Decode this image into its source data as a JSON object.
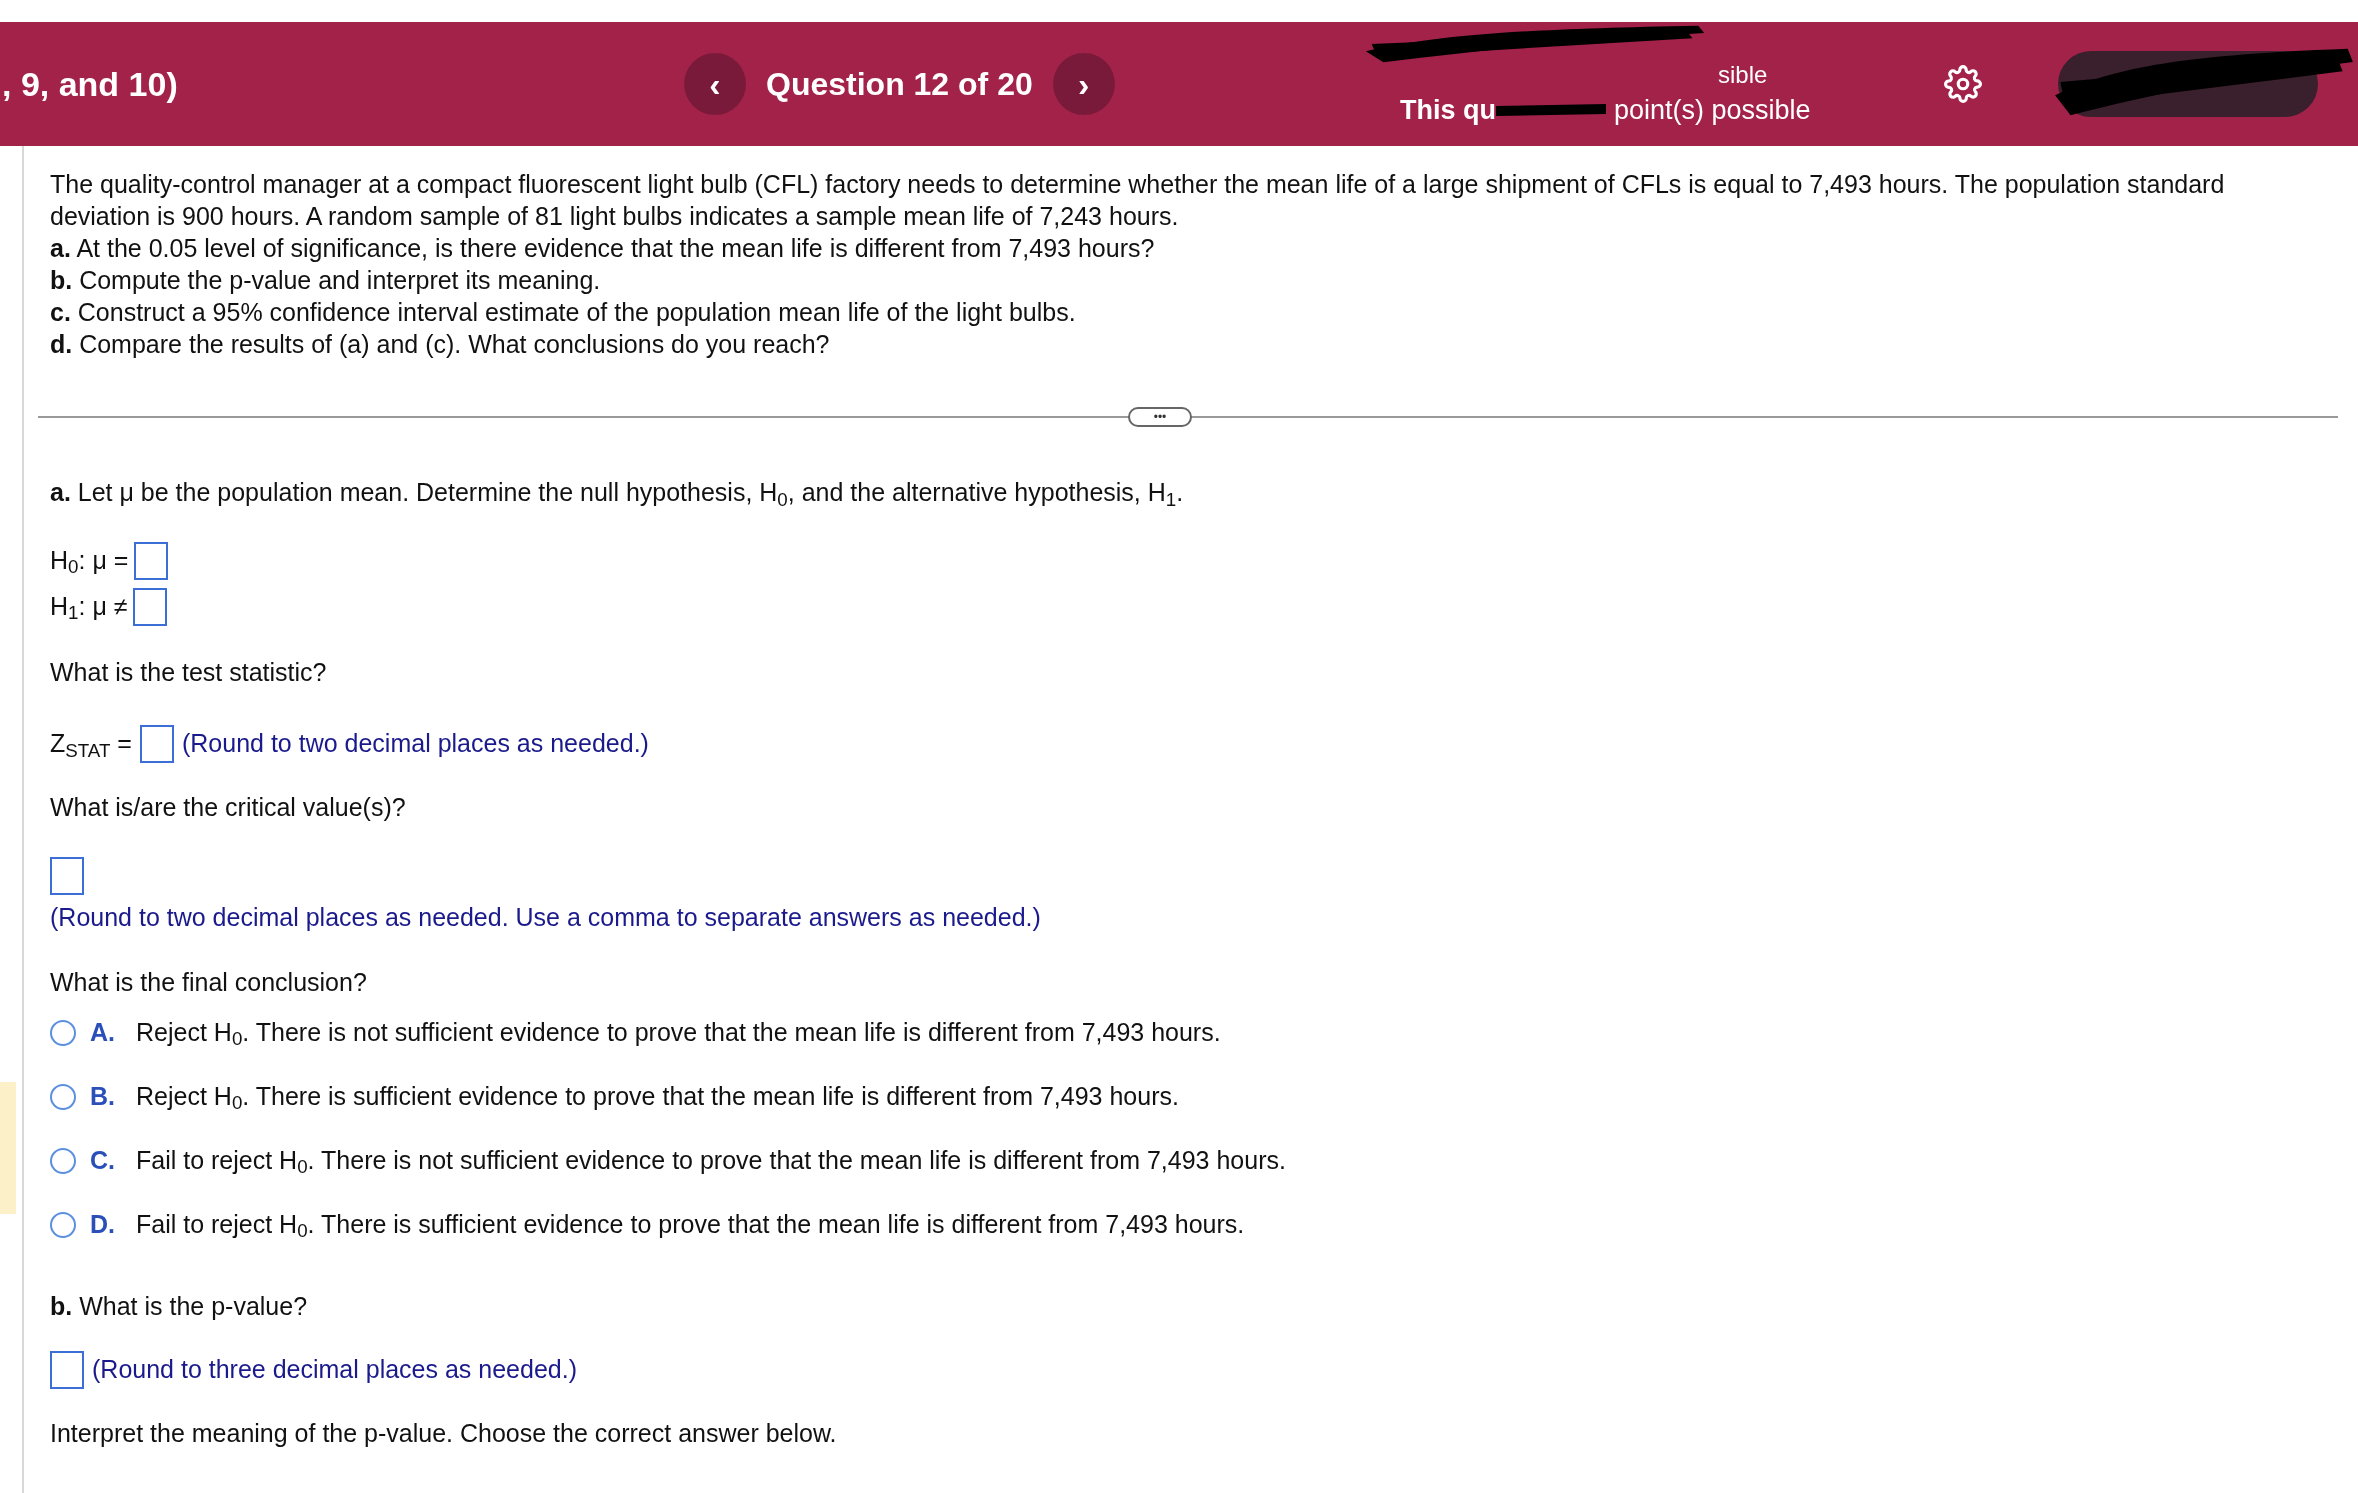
{
  "header": {
    "breadcrumb": ", 9, and 10)",
    "question_label": "Question 12 of 20",
    "prev": "‹",
    "next": "›",
    "points_top": "sible",
    "points_start": "This qu",
    "points_end": "point(s) possible"
  },
  "problem": {
    "intro": "The quality-control manager at a compact fluorescent light bulb (CFL) factory needs to determine whether the mean life of a large shipment of CFLs is equal to 7,493 hours. The population standard deviation is 900 hours. A random sample of 81 light bulbs indicates a sample mean life of 7,243 hours.",
    "parts": [
      "**a.** At the 0.05 level of significance, is there evidence that the mean life is different from 7,493 hours?",
      "**b.** Compute the p-value and interpret its meaning.",
      "**c.** Construct a 95% confidence interval estimate of the population mean life of the light bulbs.",
      "**d.** Compare the results of (a) and (c). What conclusions do you reach?"
    ]
  },
  "expand_button": "•••",
  "part_a": {
    "prompt": "**a.** Let μ be the population mean. Determine the null hypothesis, H$_{0}$, and the alternative hypothesis, H$_{1}$.",
    "hypotheses": [
      {
        "label": "H$_{0}$: μ ="
      },
      {
        "label": "H$_{1}$: μ ≠"
      }
    ],
    "test_stat_question": "What is the test statistic?",
    "zstat_label": "Z$_{STAT}$ =",
    "zstat_hint": "(Round to two decimal places as needed.)",
    "critical_question": "What is/are the critical value(s)?",
    "critical_hint": "(Round to two decimal places as needed. Use a comma to separate answers as needed.)",
    "conclusion_question": "What is the final conclusion?",
    "options": [
      {
        "letter": "A.",
        "text": "Reject H$_{0}$. There is not sufficient evidence to prove that the mean life is different from 7,493 hours.",
        "selected": false
      },
      {
        "letter": "B.",
        "text": "Reject H$_{0}$. There is sufficient evidence to prove that the mean life is different from 7,493 hours.",
        "selected": false
      },
      {
        "letter": "C.",
        "text": "Fail to reject H$_{0}$. There is not sufficient evidence to prove that the mean life is different from 7,493 hours.",
        "selected": false
      },
      {
        "letter": "D.",
        "text": "Fail to reject H$_{0}$. There is sufficient evidence to prove that the mean life is different from 7,493 hours.",
        "selected": false
      }
    ]
  },
  "part_b": {
    "prompt": "**b.** What is the p-value?",
    "hint": "(Round to three decimal places as needed.)",
    "interpret": "Interpret the meaning of the p-value. Choose the correct answer below."
  }
}
